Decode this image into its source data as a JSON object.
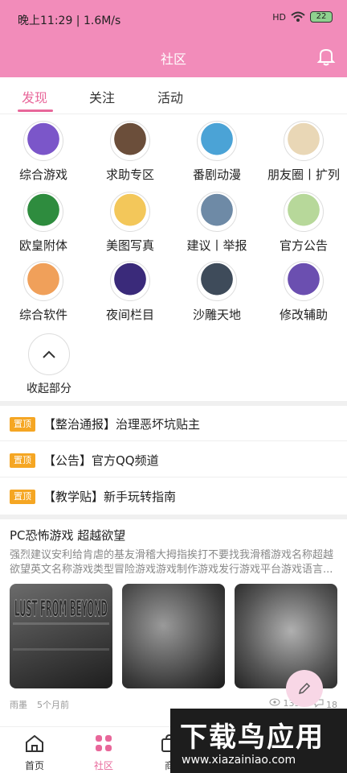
{
  "status_bar": {
    "time": "晚上11:29 | 1.6M/s",
    "signal": "HD",
    "battery": "22"
  },
  "header": {
    "title": "社区"
  },
  "tabs": [
    {
      "label": "发现"
    },
    {
      "label": "关注"
    },
    {
      "label": "活动"
    }
  ],
  "categories": [
    {
      "label": "综合游戏",
      "color": "#7b56c9"
    },
    {
      "label": "求助专区",
      "color": "#6b4e3a"
    },
    {
      "label": "番剧动漫",
      "color": "#4ba3d6"
    },
    {
      "label": "朋友圈丨扩列",
      "color": "#e9d7b6"
    },
    {
      "label": "欧皇附体",
      "color": "#2e8c3e"
    },
    {
      "label": "美图写真",
      "color": "#f3c75a"
    },
    {
      "label": "建议丨举报",
      "color": "#6e8aa6"
    },
    {
      "label": "官方公告",
      "color": "#b7d89a"
    },
    {
      "label": "综合软件",
      "color": "#f0a05a"
    },
    {
      "label": "夜间栏目",
      "color": "#3a2a7a"
    },
    {
      "label": "沙雕天地",
      "color": "#3e4b5a"
    },
    {
      "label": "修改辅助",
      "color": "#6b4fb0"
    }
  ],
  "collapse_label": "收起部分",
  "pinned_badge": "置顶",
  "pinned_posts": [
    {
      "title": "【整治通报】治理恶坏坑贴主"
    },
    {
      "title": "【公告】官方QQ频道"
    },
    {
      "title": "【教学贴】新手玩转指南"
    }
  ],
  "post": {
    "title": "PC恐怖游戏  超越欲望",
    "description": "强烈建议安利给肯虐的基友滑稽大拇指挨打不要找我滑稽游戏名称超越欲望英文名称游戏类型冒险游戏游戏制作游戏发行游戏平台游戏语言...",
    "thumb_text": "LUST FROM BEYOND",
    "author": "雨墨",
    "time": "5个月前",
    "views": "1358",
    "comments": "18"
  },
  "bottom_nav": [
    {
      "label": "首页"
    },
    {
      "label": "社区"
    },
    {
      "label": "商"
    }
  ],
  "watermark": {
    "big": "下载鸟应用",
    "small": "www.xiazainiao.com"
  },
  "colors": {
    "accent": "#f28cba",
    "active": "#e8679a",
    "pin": "#f5a623"
  }
}
